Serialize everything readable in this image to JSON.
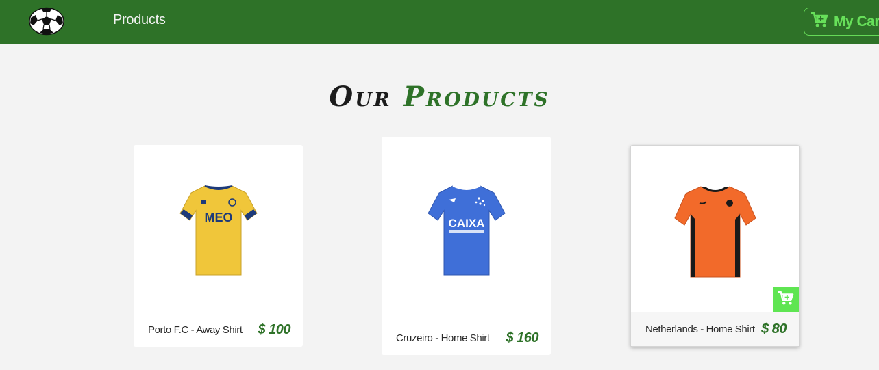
{
  "nav": {
    "products_label": "Products",
    "cart_label": "My Cart"
  },
  "heading": {
    "word1": "Our",
    "word2": "Products"
  },
  "products": [
    {
      "name": "Porto F.C - Away Shirt",
      "price": "$ 100",
      "shirt_color": "#f0c63a",
      "trim_color": "#1d3a7a",
      "sponsor": "MEO"
    },
    {
      "name": "Cruzeiro - Home Shirt",
      "price": "$ 160",
      "shirt_color": "#3f6fd8",
      "trim_color": "#ffffff",
      "sponsor": "CAIXA"
    },
    {
      "name": "Netherlands - Home Shirt",
      "price": "$ 80",
      "shirt_color": "#f26a2a",
      "trim_color": "#1a1a1a",
      "sponsor": ""
    }
  ],
  "colors": {
    "navbar": "#2e7228",
    "accent_green": "#67e05a",
    "price_green": "#2e7228"
  }
}
